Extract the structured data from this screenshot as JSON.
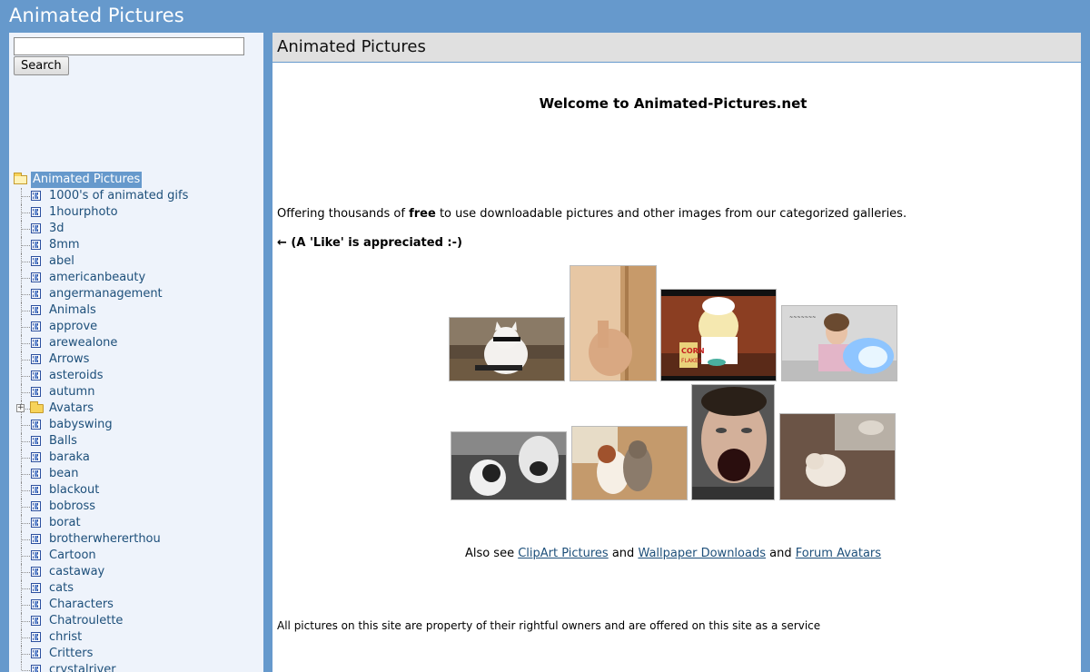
{
  "site": {
    "title": "Animated Pictures"
  },
  "search": {
    "placeholder": "",
    "button_label": "Search"
  },
  "tree": {
    "root_label": "Animated Pictures",
    "items": [
      {
        "label": "1000's of animated gifs",
        "type": "gallery"
      },
      {
        "label": "1hourphoto",
        "type": "gallery"
      },
      {
        "label": "3d",
        "type": "gallery"
      },
      {
        "label": "8mm",
        "type": "gallery"
      },
      {
        "label": "abel",
        "type": "gallery"
      },
      {
        "label": "americanbeauty",
        "type": "gallery"
      },
      {
        "label": "angermanagement",
        "type": "gallery"
      },
      {
        "label": "Animals",
        "type": "gallery"
      },
      {
        "label": "approve",
        "type": "gallery"
      },
      {
        "label": "arewealone",
        "type": "gallery"
      },
      {
        "label": "Arrows",
        "type": "gallery"
      },
      {
        "label": "asteroids",
        "type": "gallery"
      },
      {
        "label": "autumn",
        "type": "gallery"
      },
      {
        "label": "Avatars",
        "type": "folder"
      },
      {
        "label": "babyswing",
        "type": "gallery"
      },
      {
        "label": "Balls",
        "type": "gallery"
      },
      {
        "label": "baraka",
        "type": "gallery"
      },
      {
        "label": "bean",
        "type": "gallery"
      },
      {
        "label": "blackout",
        "type": "gallery"
      },
      {
        "label": "bobross",
        "type": "gallery"
      },
      {
        "label": "borat",
        "type": "gallery"
      },
      {
        "label": "brotherwhererthou",
        "type": "gallery"
      },
      {
        "label": "Cartoon",
        "type": "gallery"
      },
      {
        "label": "castaway",
        "type": "gallery"
      },
      {
        "label": "cats",
        "type": "gallery"
      },
      {
        "label": "Characters",
        "type": "gallery"
      },
      {
        "label": "Chatroulette",
        "type": "gallery"
      },
      {
        "label": "christ",
        "type": "gallery"
      },
      {
        "label": "Critters",
        "type": "gallery"
      },
      {
        "label": "crystalriver",
        "type": "gallery"
      }
    ]
  },
  "main": {
    "header_title": "Animated Pictures",
    "welcome": "Welcome to Animated-Pictures.net",
    "offering_before": "Offering thousands of ",
    "offering_bold": "free",
    "offering_after": " to use downloadable pictures and other images from our categorized galleries.",
    "like_text": "← (A 'Like' is appreciated :-)",
    "also_see_prefix": "Also see ",
    "link_clipart": "ClipArt Pictures",
    "and1": " and ",
    "link_wallpaper": "Wallpaper Downloads",
    "and2": " and ",
    "link_avatars": "Forum Avatars",
    "footer": "All pictures on this site are property of their rightful owners and are offered on this site as a service"
  },
  "colors": {
    "page_bg": "#6699cc",
    "sidebar_bg": "#eef3fb",
    "link": "#1d4f7a",
    "header_bar": "#e0e0e0"
  },
  "thumbnails": [
    {
      "name": "cat-sunglasses-thumbnail"
    },
    {
      "name": "hand-door-thumbnail"
    },
    {
      "name": "homer-cornflakes-thumbnail"
    },
    {
      "name": "girl-fireball-thumbnail"
    },
    {
      "name": "scared-cat-thumbnail"
    },
    {
      "name": "puppy-kitten-thumbnail"
    },
    {
      "name": "screaming-face-thumbnail"
    },
    {
      "name": "rolling-kitten-thumbnail"
    }
  ]
}
